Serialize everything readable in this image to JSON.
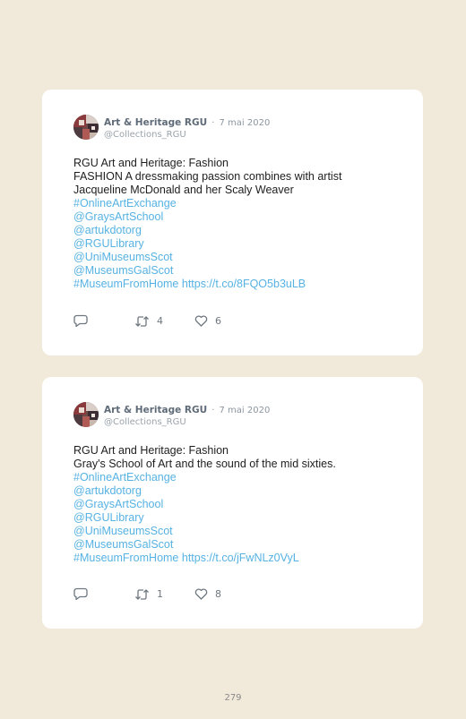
{
  "tweets": [
    {
      "author": "Art & Heritage RGU",
      "separator": "·",
      "date": "7 mai 2020",
      "handle": "@Collections_RGU",
      "lines": [
        {
          "text": "RGU Art and Heritage: Fashion",
          "type": "text"
        },
        {
          "text": "FASHION A dressmaking passion combines with artist",
          "type": "text"
        },
        {
          "text": "Jacqueline McDonald and her Scaly Weaver",
          "type": "text"
        },
        {
          "text": "#OnlineArtExchange",
          "type": "link"
        },
        {
          "text": "@GraysArtSchool",
          "type": "link"
        },
        {
          "text": "@artukdotorg",
          "type": "link"
        },
        {
          "text": "@RGULibrary",
          "type": "link"
        },
        {
          "text": "@UniMuseumsScot",
          "type": "link"
        },
        {
          "text": "@MuseumsGalScot",
          "type": "link"
        },
        {
          "text": "#MuseumFromHome https://t.co/8FQO5b3uLB",
          "type": "link"
        }
      ],
      "retweets": "4",
      "likes": "6"
    },
    {
      "author": "Art & Heritage RGU",
      "separator": "·",
      "date": "7 mai 2020",
      "handle": "@Collections_RGU",
      "lines": [
        {
          "text": "RGU Art and Heritage: Fashion",
          "type": "text"
        },
        {
          "text": "Gray's School of Art and the sound of the mid sixties.",
          "type": "text"
        },
        {
          "text": "#OnlineArtExchange",
          "type": "link"
        },
        {
          "text": "@artukdotorg",
          "type": "link"
        },
        {
          "text": "@GraysArtSchool",
          "type": "link"
        },
        {
          "text": "@RGULibrary",
          "type": "link"
        },
        {
          "text": "@UniMuseumsScot",
          "type": "link"
        },
        {
          "text": "@MuseumsGalScot",
          "type": "link"
        },
        {
          "text": "#MuseumFromHome https://t.co/jFwNLz0VyL",
          "type": "link"
        }
      ],
      "retweets": "1",
      "likes": "8"
    }
  ],
  "page_number": "279",
  "colors": {
    "background": "#f1eada",
    "card": "#ffffff",
    "link": "#56b2e3",
    "text": "#1e1e1e",
    "author": "#5f6b78",
    "icon": "#6e7780"
  },
  "icons": {
    "reply": "reply-icon",
    "retweet": "retweet-icon",
    "like": "heart-icon",
    "avatar": "avatar"
  }
}
